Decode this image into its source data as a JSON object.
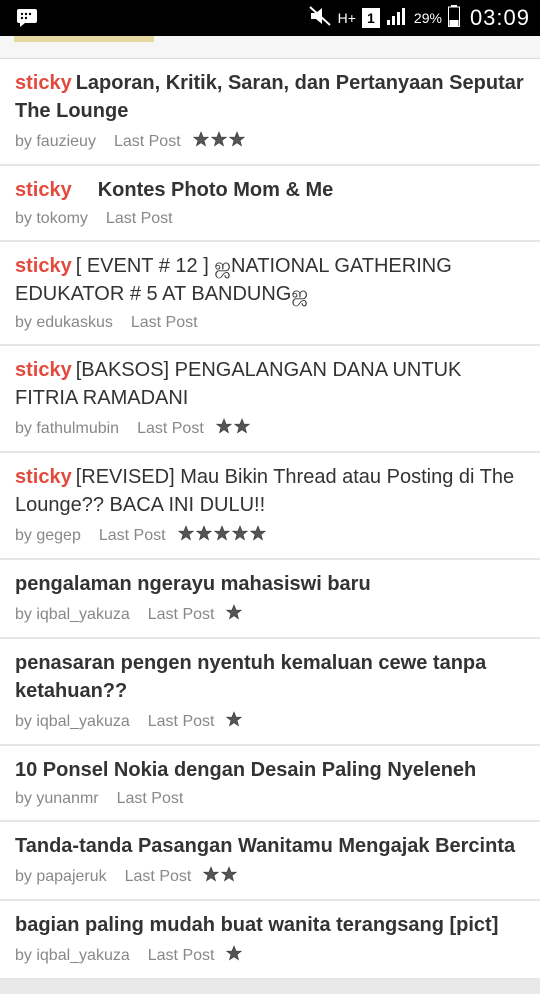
{
  "status_bar": {
    "network": "H+",
    "sim_slot": "1",
    "battery": "29%",
    "time": "03:09"
  },
  "threads": [
    {
      "sticky": "sticky",
      "title": "Laporan, Kritik, Saran, dan Pertanyaan Seputar The Lounge",
      "bold": true,
      "author": "by fauzieuy",
      "last_post": "Last Post",
      "stars": 3
    },
    {
      "sticky": "sticky",
      "title": "Kontes Photo Mom & Me",
      "bold": true,
      "author": "by tokomy",
      "last_post": "Last Post",
      "stars": 0
    },
    {
      "sticky": "sticky",
      "title": "[ EVENT # 12 ] ஜNATIONAL GATHERING EDUKATOR # 5 AT BANDUNGஜ",
      "bold": false,
      "author": "by edukaskus",
      "last_post": "Last Post",
      "stars": 0
    },
    {
      "sticky": "sticky",
      "title": "[BAKSOS] PENGALANGAN DANA UNTUK FITRIA RAMADANI",
      "bold": false,
      "author": "by fathulmubin",
      "last_post": "Last Post",
      "stars": 2
    },
    {
      "sticky": "sticky",
      "title": "[REVISED] Mau Bikin Thread atau Posting di The Lounge?? BACA INI DULU!!",
      "bold": false,
      "author": "by gegep",
      "last_post": "Last Post",
      "stars": 5
    },
    {
      "sticky": "",
      "title": "pengalaman ngerayu mahasiswi baru",
      "bold": true,
      "author": "by iqbal_yakuza",
      "last_post": "Last Post",
      "stars": 1
    },
    {
      "sticky": "",
      "title": "penasaran pengen nyentuh kemaluan cewe tanpa ketahuan??",
      "bold": true,
      "author": "by iqbal_yakuza",
      "last_post": "Last Post",
      "stars": 1
    },
    {
      "sticky": "",
      "title": "10 Ponsel Nokia dengan Desain Paling Nyeleneh",
      "bold": true,
      "author": "by yunanmr",
      "last_post": "Last Post",
      "stars": 0
    },
    {
      "sticky": "",
      "title": "Tanda-tanda Pasangan Wanitamu Mengajak Bercinta",
      "bold": true,
      "author": "by papajeruk",
      "last_post": "Last Post",
      "stars": 2
    },
    {
      "sticky": "",
      "title": "bagian paling mudah buat wanita terangsang [pict]",
      "bold": true,
      "author": "by iqbal_yakuza",
      "last_post": "Last Post",
      "stars": 1
    }
  ],
  "colors": {
    "sticky": "#e34a3d",
    "text": "#333333",
    "meta": "#888888"
  },
  "icons": {
    "notification": "chat-icon",
    "mute": "mute-icon",
    "signal": "signal-icon",
    "battery": "battery-icon",
    "rating": "star-icon"
  }
}
